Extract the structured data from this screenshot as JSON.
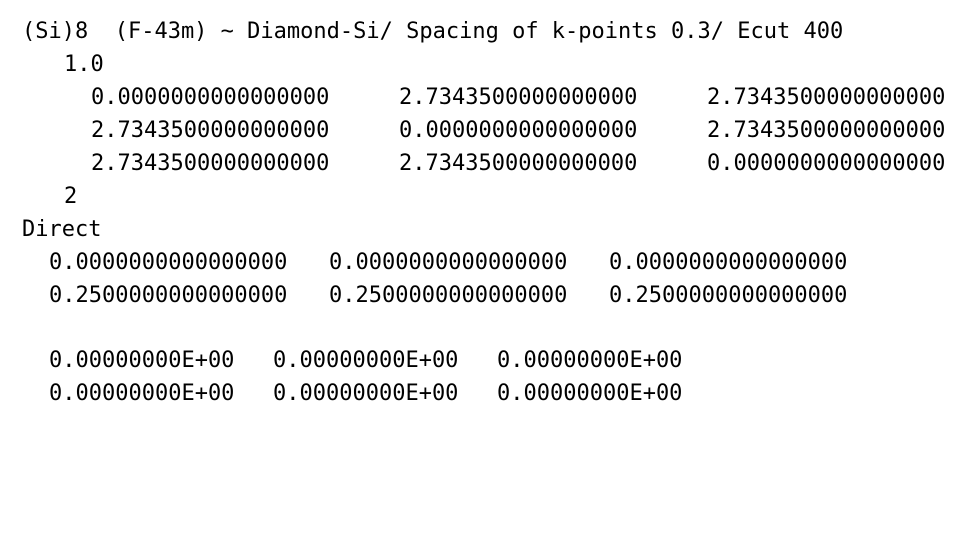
{
  "poscar": {
    "comment": "(Si)8  (F-43m) ~ Diamond-Si/ Spacing of k-points 0.3/ Ecut 400",
    "scale": "1.0",
    "lattice": [
      [
        "0.0000000000000000",
        "2.7343500000000000",
        "2.7343500000000000"
      ],
      [
        "2.7343500000000000",
        "0.0000000000000000",
        "2.7343500000000000"
      ],
      [
        "2.7343500000000000",
        "2.7343500000000000",
        "0.0000000000000000"
      ]
    ],
    "atom_count": "2",
    "coord_mode": "Direct",
    "positions": [
      [
        "0.0000000000000000",
        "0.0000000000000000",
        "0.0000000000000000"
      ],
      [
        "0.2500000000000000",
        "0.2500000000000000",
        "0.2500000000000000"
      ]
    ],
    "velocities": [
      [
        "0.00000000E+00",
        "0.00000000E+00",
        "0.00000000E+00"
      ],
      [
        "0.00000000E+00",
        "0.00000000E+00",
        "0.00000000E+00"
      ]
    ]
  }
}
